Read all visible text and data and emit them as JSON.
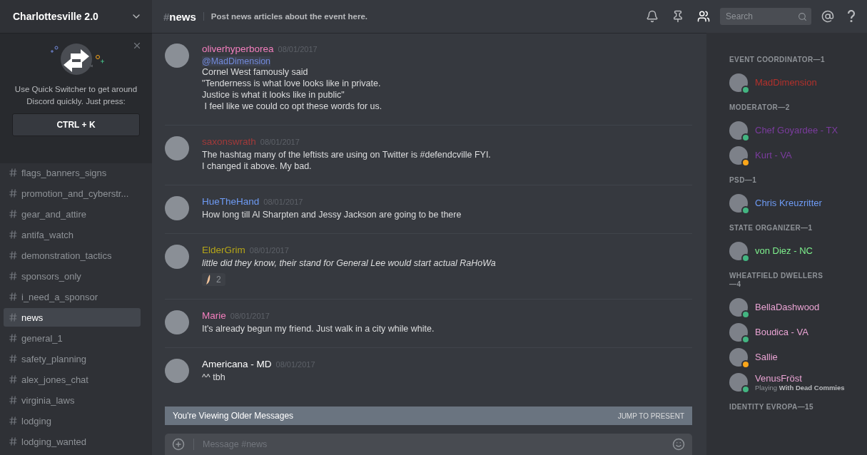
{
  "server": {
    "name": "Charlottesville 2.0"
  },
  "quick_switcher": {
    "text": "Use Quick Switcher to get around Discord quickly. Just press:",
    "shortcut": "CTRL + K"
  },
  "channels": [
    {
      "name": "flags_banners_signs",
      "selected": false
    },
    {
      "name": "promotion_and_cyberstr...",
      "selected": false
    },
    {
      "name": "gear_and_attire",
      "selected": false
    },
    {
      "name": "antifa_watch",
      "selected": false
    },
    {
      "name": "demonstration_tactics",
      "selected": false
    },
    {
      "name": "sponsors_only",
      "selected": false
    },
    {
      "name": "i_need_a_sponsor",
      "selected": false
    },
    {
      "name": "news",
      "selected": true
    },
    {
      "name": "general_1",
      "selected": false
    },
    {
      "name": "safety_planning",
      "selected": false
    },
    {
      "name": "alex_jones_chat",
      "selected": false
    },
    {
      "name": "virginia_laws",
      "selected": false
    },
    {
      "name": "lodging",
      "selected": false
    },
    {
      "name": "lodging_wanted",
      "selected": false
    }
  ],
  "header": {
    "hash": "#",
    "channel": "news",
    "topic": "Post news articles about the event here.",
    "search_placeholder": "Search"
  },
  "messages": [
    {
      "author": "oliverhyperborea",
      "color": "#f47fbe",
      "time": "08/01/2017",
      "mention": "@MadDimension",
      "italic": false,
      "lines": [
        "Cornel West famously said",
        "\"Tenderness is what love looks like in private.",
        "Justice is what it looks like in public\"",
        " I feel like we could co opt these words for us."
      ]
    },
    {
      "author": "saxonswrath",
      "color": "#a33a3a",
      "time": "08/01/2017",
      "italic": false,
      "lines": [
        "The hashtag many of the leftists are using on Twitter is #defendcville FYI.",
        "I changed it above. My bad."
      ]
    },
    {
      "author": "HueTheHand",
      "color": "#6e9bf5",
      "time": "08/01/2017",
      "italic": false,
      "lines": [
        "How long till Al Sharpten and Jessy Jackson are going to be there"
      ]
    },
    {
      "author": "ElderGrim",
      "color": "#b5a518",
      "time": "08/01/2017",
      "italic": true,
      "lines": [
        "little did they know, their stand for General Lee would start actual RaHoWa"
      ],
      "reaction": {
        "count": "2"
      }
    },
    {
      "author": "Marie",
      "color": "#f47fbe",
      "time": "08/01/2017",
      "italic": false,
      "lines": [
        "It's already begun my friend. Just walk in a city while white."
      ]
    },
    {
      "author": "Americana - MD",
      "color": "#ffffff",
      "time": "08/01/2017",
      "italic": false,
      "lines": [
        "^^ tbh"
      ]
    }
  ],
  "older_banner": {
    "text": "You're Viewing Older Messages",
    "action": "JUMP TO PRESENT"
  },
  "composer": {
    "placeholder": "Message #news"
  },
  "member_groups": [
    {
      "title": "EVENT COORDINATOR—1",
      "members": [
        {
          "name": "MadDimension",
          "color": "#b3312c",
          "status": {
            "color": "#43b581"
          }
        }
      ]
    },
    {
      "title": "MODERATOR—2",
      "members": [
        {
          "name": "Chef Goyardee - TX",
          "color": "#7b3c9e",
          "status": {
            "color": "#43b581"
          }
        },
        {
          "name": "Kurt - VA",
          "color": "#7b3c9e",
          "status": {
            "color": "#faa61a"
          }
        }
      ]
    },
    {
      "title": "PSD—1",
      "members": [
        {
          "name": "Chris Kreuzritter",
          "color": "#6e9bf5",
          "status": {
            "color": "#43b581"
          }
        }
      ]
    },
    {
      "title": "STATE ORGANIZER—1",
      "members": [
        {
          "name": "von Diez - NC",
          "color": "#7ef08d",
          "status": {
            "color": "#43b581"
          }
        }
      ]
    },
    {
      "title": "WHEATFIELD DWELLERS—4",
      "members": [
        {
          "name": "BellaDashwood",
          "color": "#e9a3d3",
          "status": {
            "color": "#43b581"
          }
        },
        {
          "name": "Boudica - VA",
          "color": "#e9a3d3",
          "status": {
            "color": "#43b581"
          }
        },
        {
          "name": "Sallie",
          "color": "#e9a3d3",
          "status": {
            "color": "#faa61a"
          }
        },
        {
          "name": "VenusFröst",
          "color": "#e9a3d3",
          "status": {
            "color": "#43b581"
          },
          "activity": "Playing **With Dead Commies**"
        }
      ]
    },
    {
      "title": "IDENTITY EVROPA—15"
    }
  ]
}
